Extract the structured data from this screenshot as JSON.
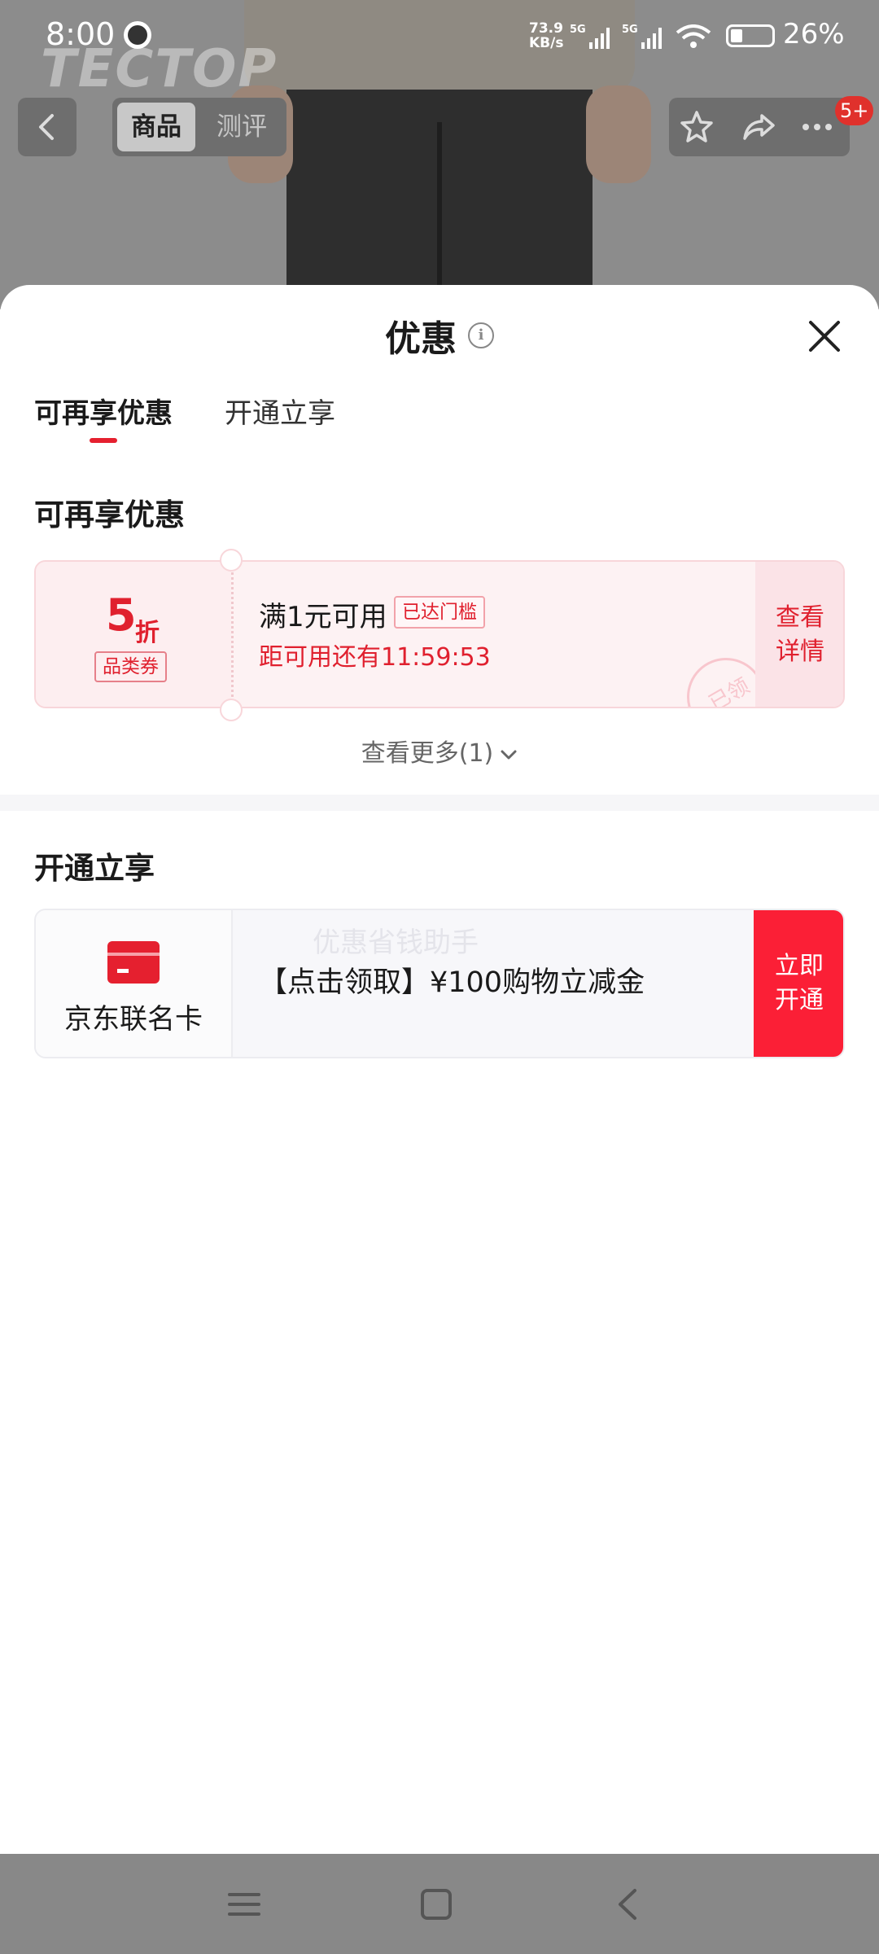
{
  "status_bar": {
    "time": "8:00",
    "net_speed_value": "73.9",
    "net_speed_unit": "KB/s",
    "signal_1": "5G",
    "signal_2": "5G",
    "battery": "26%"
  },
  "watermark": "TECTOP",
  "product_nav": {
    "tabs": [
      {
        "label": "商品"
      },
      {
        "label": "测评"
      }
    ],
    "badge": "5+"
  },
  "sheet": {
    "title": "优惠",
    "tabs": [
      {
        "label": "可再享优惠"
      },
      {
        "label": "开通立享"
      }
    ],
    "section1_title": "可再享优惠",
    "coupon": {
      "discount_value": "5",
      "discount_unit": "折",
      "type_tag": "品类券",
      "condition": "满1元可用",
      "status_tag": "已达门槛",
      "countdown": "距可用还有11:59:53",
      "detail_line1": "查看",
      "detail_line2": "详情",
      "stamp": "已领"
    },
    "see_more": "查看更多(1)",
    "section2_title": "开通立享",
    "card_offer": {
      "card_name": "京东联名卡",
      "overlay_text": "优惠省钱助手",
      "offer_text": "【点击领取】¥100购物立减金",
      "button_line1": "立即",
      "button_line2": "开通"
    }
  },
  "colors": {
    "accent_red": "#e5202f",
    "button_red": "#fb1f36",
    "coupon_bg": "#fdf2f3"
  },
  "icons": [
    "back-icon",
    "star-icon",
    "share-icon",
    "more-icon",
    "info-icon",
    "close-icon",
    "chevron-down-icon",
    "credit-card-icon",
    "menu-icon",
    "home-icon",
    "nav-back-icon"
  ]
}
